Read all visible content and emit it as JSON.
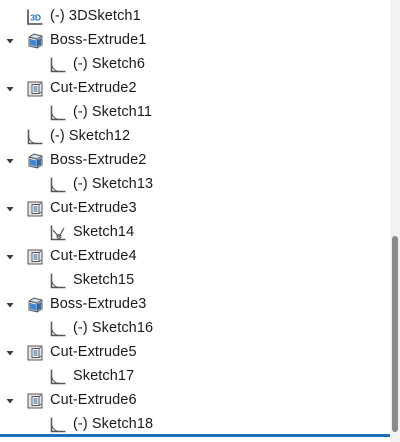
{
  "feature_tree": {
    "items": [
      {
        "label": "(-) 3DSketch1",
        "icon": "3d-sketch-icon",
        "expandable": false,
        "level": 0
      },
      {
        "label": "Boss-Extrude1",
        "icon": "boss-extrude-icon",
        "expandable": true,
        "expanded": true,
        "level": 0
      },
      {
        "label": "(-) Sketch6",
        "icon": "sketch-icon",
        "expandable": false,
        "level": 1
      },
      {
        "label": "Cut-Extrude2",
        "icon": "cut-extrude-icon",
        "expandable": true,
        "expanded": true,
        "level": 0
      },
      {
        "label": "(-) Sketch11",
        "icon": "sketch-icon",
        "expandable": false,
        "level": 1
      },
      {
        "label": "(-) Sketch12",
        "icon": "sketch-icon",
        "expandable": false,
        "level": 0
      },
      {
        "label": "Boss-Extrude2",
        "icon": "boss-extrude-icon",
        "expandable": true,
        "expanded": true,
        "level": 0
      },
      {
        "label": "(-) Sketch13",
        "icon": "sketch-icon",
        "expandable": false,
        "level": 1
      },
      {
        "label": "Cut-Extrude3",
        "icon": "cut-extrude-icon",
        "expandable": true,
        "expanded": true,
        "level": 0
      },
      {
        "label": "Sketch14",
        "icon": "sketch-fully-defined-icon",
        "expandable": false,
        "level": 1
      },
      {
        "label": "Cut-Extrude4",
        "icon": "cut-extrude-icon",
        "expandable": true,
        "expanded": true,
        "level": 0
      },
      {
        "label": "Sketch15",
        "icon": "sketch-icon",
        "expandable": false,
        "level": 1
      },
      {
        "label": "Boss-Extrude3",
        "icon": "boss-extrude-icon",
        "expandable": true,
        "expanded": true,
        "level": 0
      },
      {
        "label": "(-) Sketch16",
        "icon": "sketch-icon",
        "expandable": false,
        "level": 1
      },
      {
        "label": "Cut-Extrude5",
        "icon": "cut-extrude-icon",
        "expandable": true,
        "expanded": true,
        "level": 0
      },
      {
        "label": "Sketch17",
        "icon": "sketch-icon",
        "expandable": false,
        "level": 1
      },
      {
        "label": "Cut-Extrude6",
        "icon": "cut-extrude-icon",
        "expandable": true,
        "expanded": true,
        "level": 0
      },
      {
        "label": "(-) Sketch18",
        "icon": "sketch-icon",
        "expandable": false,
        "level": 1
      }
    ]
  },
  "colors": {
    "accent": "#1a6fc0",
    "boss_fill": "#3d8bd9",
    "sketch_line": "#555555"
  }
}
